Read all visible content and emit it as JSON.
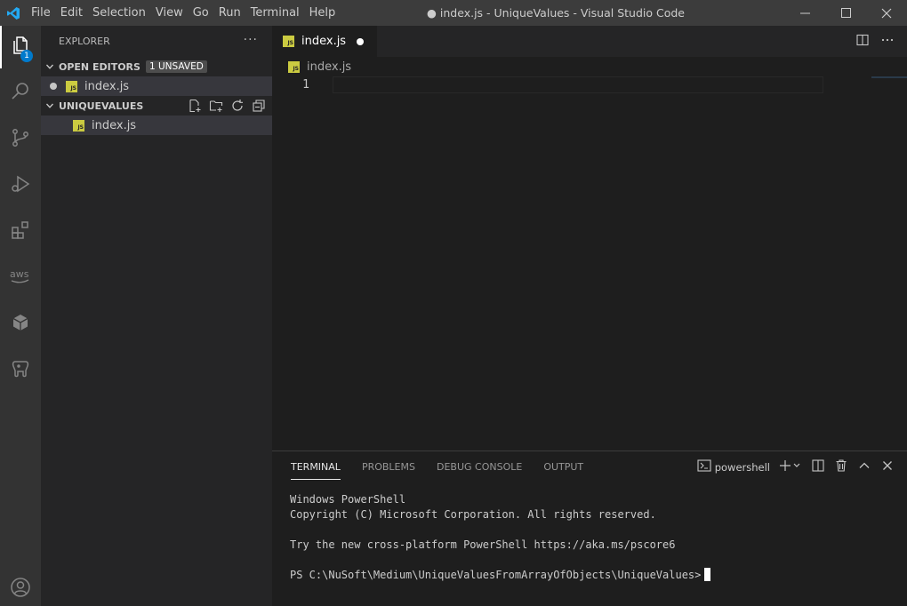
{
  "menu": [
    "File",
    "Edit",
    "Selection",
    "View",
    "Go",
    "Run",
    "Terminal",
    "Help"
  ],
  "window_title": "● index.js - UniqueValues - Visual Studio Code",
  "activity": {
    "explorer_badge": "1"
  },
  "sidebar": {
    "title": "EXPLORER",
    "more": "···",
    "open_editors": {
      "label": "OPEN EDITORS",
      "badge": "1 UNSAVED",
      "file": "index.js"
    },
    "folder": {
      "label": "UNIQUEVALUES",
      "file": "index.js"
    }
  },
  "editor": {
    "tab_label": "index.js",
    "breadcrumb": "index.js",
    "line_number": "1"
  },
  "panel": {
    "tabs": [
      "TERMINAL",
      "PROBLEMS",
      "DEBUG CONSOLE",
      "OUTPUT"
    ],
    "shell": "powershell",
    "terminal_lines": [
      "Windows PowerShell",
      "Copyright (C) Microsoft Corporation. All rights reserved.",
      "",
      "Try the new cross-platform PowerShell https://aka.ms/pscore6",
      "",
      "PS C:\\NuSoft\\Medium\\UniqueValuesFromArrayOfObjects\\UniqueValues>"
    ]
  },
  "colors": {
    "accent": "#007acc",
    "js_icon": "#cbcb41",
    "vscode_logo": "#23a9f2"
  }
}
